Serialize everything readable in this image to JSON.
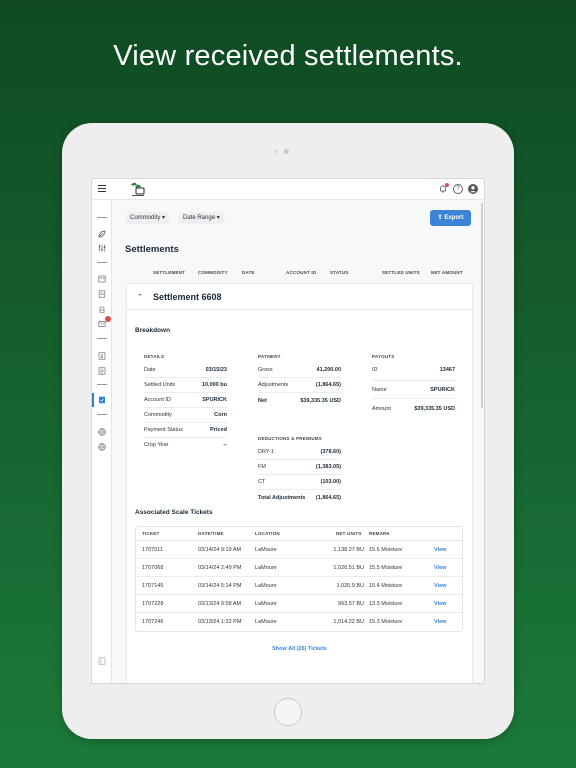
{
  "headline": "View received settlements.",
  "colors": {
    "accent": "#3b84d8",
    "alert": "#e54b4b",
    "background": "#155f2d"
  },
  "topbar": {
    "icons": [
      "menu-icon",
      "logo",
      "bell-icon",
      "help-icon",
      "user-icon"
    ]
  },
  "filters": {
    "commodity": "Commodity",
    "date_range": "Date Range"
  },
  "export_label": "Export",
  "page_title": "Settlements",
  "columns": [
    "SETTLEMENT",
    "COMMODITY",
    "DATE",
    "ACCOUNT ID",
    "STATUS",
    "SETTLED UNITS",
    "NET AMOUNT"
  ],
  "settlement": {
    "title": "Settlement 6608",
    "breakdown_title": "Breakdown",
    "details": {
      "title": "DETAILS",
      "rows": [
        {
          "k": "Date",
          "v": "03/15/23"
        },
        {
          "k": "Settled Units",
          "v": "10,000 bu"
        },
        {
          "k": "Account ID",
          "v": "SPURICK"
        },
        {
          "k": "Commodity",
          "v": "Corn"
        },
        {
          "k": "Payment Status",
          "v": "Priced"
        },
        {
          "k": "Crop Year",
          "v": "--"
        }
      ]
    },
    "payment": {
      "title": "PAYMENT",
      "rows": [
        {
          "k": "Gross",
          "v": "41,200.00"
        },
        {
          "k": "Adjustments",
          "v": "(1,864.65)"
        },
        {
          "k": "Net",
          "v": "$39,335.35 USD"
        }
      ]
    },
    "deductions": {
      "title": "DEDUCTIONS & PREMIUMS",
      "rows": [
        {
          "k": "DRY-1",
          "v": "(378.60)"
        },
        {
          "k": "FM",
          "v": "(1,383.05)"
        },
        {
          "k": "CT",
          "v": "(103.00)"
        },
        {
          "k": "Total Adjustments",
          "v": "(1,864.65)"
        }
      ]
    },
    "payouts": {
      "title": "PAYOUTS",
      "rows": [
        {
          "k": "ID",
          "v": "13467"
        },
        {
          "k": "Name",
          "v": "SPURICK"
        },
        {
          "k": "Amount",
          "v": "$39,335.35 USD"
        }
      ]
    },
    "tickets": {
      "title": "Associated Scale Tickets",
      "headers": [
        "TICKET",
        "DATE/TIME",
        "LOCATION",
        "NET UNITS",
        "REMARK"
      ],
      "rows": [
        {
          "ticket": "1707011",
          "datetime": "03/14/24 9:19 AM",
          "location": "LaMoure",
          "net_units": "1,138.27 BU",
          "remark": "15.6 Moisture",
          "action": "View"
        },
        {
          "ticket": "1707068",
          "datetime": "03/14/24 2:49 PM",
          "location": "LaMoure",
          "net_units": "1,020.51 BU",
          "remark": "15.5 Moisture",
          "action": "View"
        },
        {
          "ticket": "1707145",
          "datetime": "03/14/24 5:14 PM",
          "location": "LaMoure",
          "net_units": "1,020.9 BU",
          "remark": "15.4 Moisture",
          "action": "View"
        },
        {
          "ticket": "1707228",
          "datetime": "03/13/24 9:58 AM",
          "location": "LaMoure",
          "net_units": "993.57 BU",
          "remark": "13.3 Moisture",
          "action": "View"
        },
        {
          "ticket": "1707246",
          "datetime": "03/13/24 1:32 PM",
          "location": "LaMoure",
          "net_units": "1,014.22 BU",
          "remark": "15.3 Moisture",
          "action": "View"
        }
      ],
      "show_all": "Show All (26) Tickets"
    }
  }
}
